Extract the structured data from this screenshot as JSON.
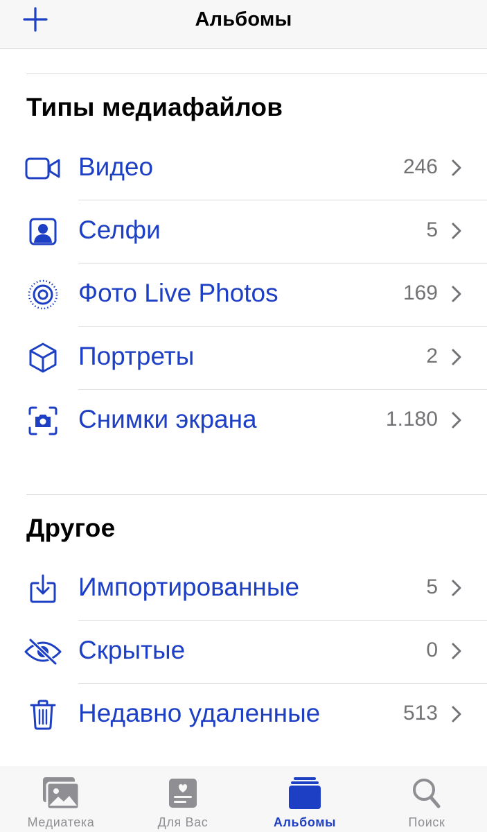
{
  "navbar": {
    "title": "Альбомы",
    "add_icon": "plus-icon"
  },
  "colors": {
    "accent": "#1d3fc4",
    "count": "#727276",
    "tab_inactive": "#8e8e93"
  },
  "sections": [
    {
      "title": "Типы медиафайлов",
      "items": [
        {
          "icon": "video-icon",
          "label": "Видео",
          "count": "246"
        },
        {
          "icon": "selfie-icon",
          "label": "Селфи",
          "count": "5"
        },
        {
          "icon": "live-photo-icon",
          "label": "Фото Live Photos",
          "count": "169"
        },
        {
          "icon": "cube-icon",
          "label": "Портреты",
          "count": "2"
        },
        {
          "icon": "screenshot-icon",
          "label": "Снимки экрана",
          "count": "1.180"
        }
      ]
    },
    {
      "title": "Другое",
      "items": [
        {
          "icon": "import-icon",
          "label": "Импортированные",
          "count": "5"
        },
        {
          "icon": "eye-slash-icon",
          "label": "Скрытые",
          "count": "0"
        },
        {
          "icon": "trash-icon",
          "label": "Недавно удаленные",
          "count": "513"
        }
      ]
    }
  ],
  "tabbar": {
    "tabs": [
      {
        "icon": "photos-library-icon",
        "label": "Медиатека",
        "active": false
      },
      {
        "icon": "for-you-icon",
        "label": "Для Вас",
        "active": false
      },
      {
        "icon": "albums-icon",
        "label": "Альбомы",
        "active": true
      },
      {
        "icon": "search-icon",
        "label": "Поиск",
        "active": false
      }
    ]
  }
}
